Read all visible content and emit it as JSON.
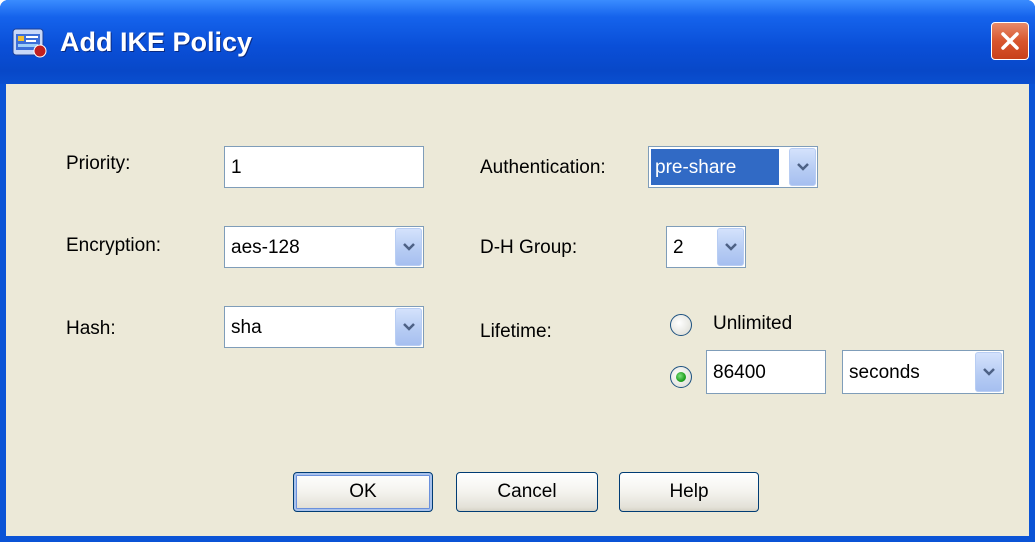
{
  "window": {
    "title": "Add IKE Policy",
    "icon": "ike-policy-app-icon",
    "close_icon": "close-icon"
  },
  "form": {
    "priority": {
      "label": "Priority:",
      "value": "1"
    },
    "encryption": {
      "label": "Encryption:",
      "value": "aes-128"
    },
    "hash": {
      "label": "Hash:",
      "value": "sha"
    },
    "authentication": {
      "label": "Authentication:",
      "value": "pre-share"
    },
    "dh_group": {
      "label": "D-H Group:",
      "value": "2"
    },
    "lifetime": {
      "label": "Lifetime:",
      "unlimited_label": "Unlimited",
      "unlimited_selected": false,
      "value_selected": true,
      "value": "86400",
      "unit": "seconds"
    }
  },
  "buttons": {
    "ok": "OK",
    "cancel": "Cancel",
    "help": "Help"
  },
  "colors": {
    "title_bar": "#0a4fd8",
    "dialog_bg": "#ece9d8",
    "selected_bg": "#316ac5",
    "close_button": "#d8562e"
  }
}
